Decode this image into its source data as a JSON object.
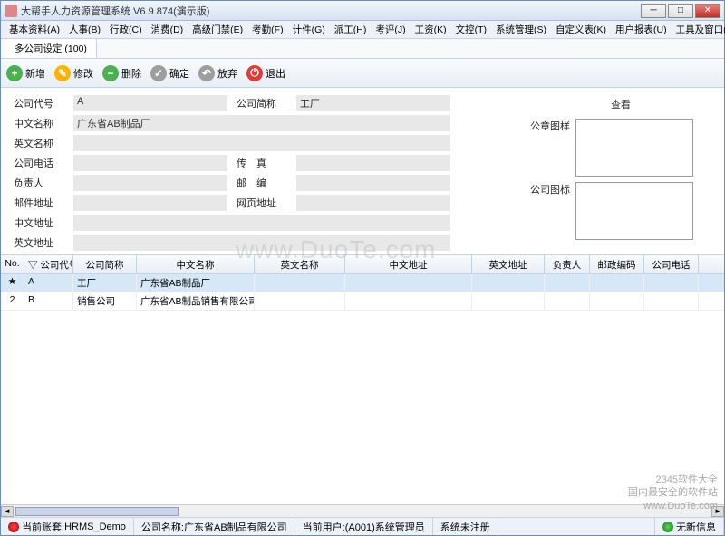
{
  "title": "大帮手人力资源管理系统 V6.9.874(演示版)",
  "menu": [
    "基本资料(A)",
    "人事(B)",
    "行政(C)",
    "消费(D)",
    "高级门禁(E)",
    "考勤(F)",
    "计件(G)",
    "派工(H)",
    "考评(J)",
    "工资(K)",
    "文控(T)",
    "系统管理(S)",
    "自定义表(K)",
    "用户报表(U)",
    "工具及窗口(W)"
  ],
  "tab": "多公司设定 (100)",
  "toolbar": {
    "add": "新增",
    "edit": "修改",
    "del": "删除",
    "ok": "确定",
    "cancel": "放弃",
    "exit": "退出"
  },
  "form": {
    "company_code_lbl": "公司代号",
    "company_code": "A",
    "short_name_lbl": "公司简称",
    "short_name": "工厂",
    "cn_name_lbl": "中文名称",
    "cn_name": "广东省AB制品厂",
    "en_name_lbl": "英文名称",
    "en_name": "",
    "tel_lbl": "公司电话",
    "tel": "",
    "fax_lbl": "传　真",
    "fax": "",
    "mgr_lbl": "负责人",
    "mgr": "",
    "zip_lbl": "邮　编",
    "zip": "",
    "email_lbl": "邮件地址",
    "email": "",
    "web_lbl": "网页地址",
    "web": "",
    "cn_addr_lbl": "中文地址",
    "cn_addr": "",
    "en_addr_lbl": "英文地址",
    "en_addr": "",
    "seal_lbl": "公章图样",
    "logo_lbl": "公司图标",
    "view_lbl": "查看"
  },
  "grid": {
    "headers": [
      "No.",
      "▽ 公司代号",
      "公司简称",
      "中文名称",
      "英文名称",
      "中文地址",
      "英文地址",
      "负责人",
      "邮政编码",
      "公司电话"
    ],
    "rows": [
      {
        "sel": true,
        "mark": "★",
        "no": "",
        "code": "A",
        "short": "工厂",
        "cn": "广东省AB制品厂",
        "en": "",
        "cnaddr": "",
        "enaddr": "",
        "mgr": "",
        "zip": "",
        "tel": ""
      },
      {
        "sel": false,
        "mark": "",
        "no": "2",
        "code": "B",
        "short": "销售公司",
        "cn": "广东省AB制品销售有限公司",
        "en": "",
        "cnaddr": "",
        "enaddr": "",
        "mgr": "",
        "zip": "",
        "tel": ""
      }
    ]
  },
  "status": {
    "account_lbl": "当前账套:",
    "account": "HRMS_Demo",
    "company_lbl": "公司名称:",
    "company": "广东省AB制品有限公司",
    "user_lbl": "当前用户:",
    "user": "(A001)系统管理员",
    "reg": "系统未注册",
    "msg": "无新信息"
  },
  "watermark": "www.DuoTe.com",
  "brand": {
    "l1": "2345软件大全",
    "l2": "国内最安全的软件站",
    "l3": "www.DuoTe.com"
  }
}
